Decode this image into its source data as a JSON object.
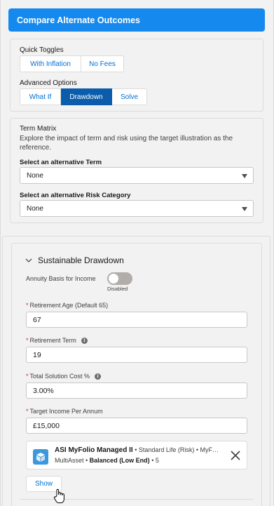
{
  "header": {
    "title": "Compare Alternate Outcomes"
  },
  "quick_toggles": {
    "label": "Quick Toggles",
    "buttons": [
      "With Inflation",
      "No Fees"
    ]
  },
  "advanced_options": {
    "label": "Advanced Options",
    "buttons": [
      "What If",
      "Drawdown",
      "Solve"
    ],
    "selected": "Drawdown"
  },
  "term_matrix": {
    "title": "Term Matrix",
    "description_line1": "Explore the impact of term and risk using the target illustration as the",
    "description_line2": "reference.",
    "term_label": "Select an alternative Term",
    "term_value": "None",
    "risk_label": "Select an alternative Risk Category",
    "risk_value": "None"
  },
  "drawdown": {
    "section_title": "Sustainable Drawdown",
    "annuity_label": "Annuity Basis for Income",
    "toggle_state": "Disabled",
    "fields": {
      "retirement_age_label": "Retirement Age (Default 65)",
      "retirement_age_value": "67",
      "retirement_term_label": "Retirement Term",
      "retirement_term_value": "19",
      "solution_cost_label": "Total Solution Cost %",
      "solution_cost_value": "3.00%",
      "target_income_label": "Target Income Per Annum",
      "target_income_value": "£15,000"
    },
    "product": {
      "title": "ASI MyFolio Managed II",
      "meta": " • Standard Life (Risk) • MyF…",
      "line2_prefix": "MultiAsset • ",
      "line2_bold": "Balanced (Low End)",
      "line2_suffix": " • 5"
    },
    "show_label": "Show"
  },
  "colors": {
    "brand": "#1589ee",
    "selected_button": "#0b5cab",
    "link": "#0070d2"
  }
}
